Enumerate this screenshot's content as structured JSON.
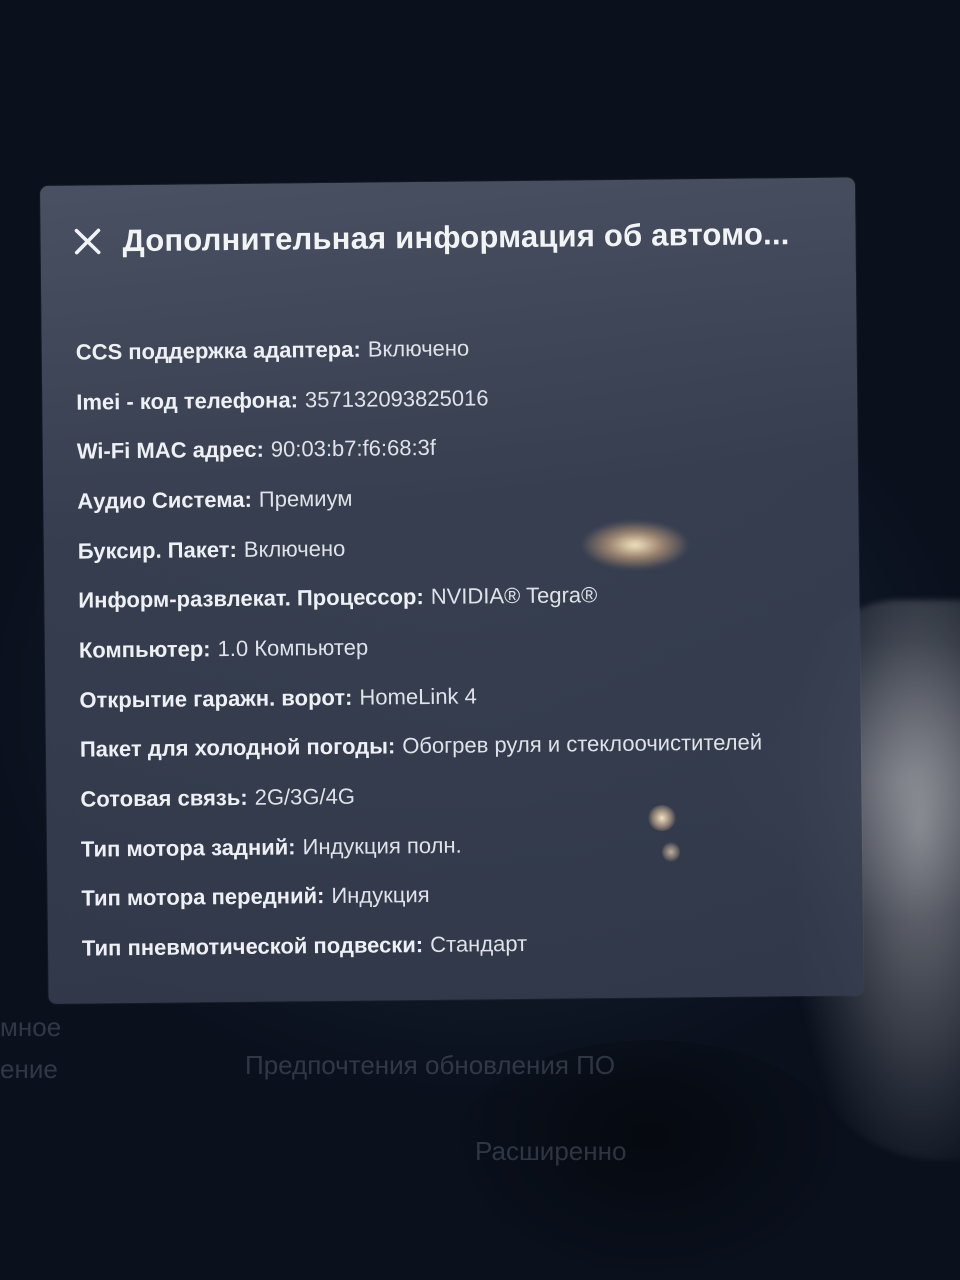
{
  "dialog": {
    "title": "Дополнительная информация об автомо...",
    "close_icon": "close-icon"
  },
  "info": [
    {
      "key": "CCS поддержка адаптера",
      "value": "Включено"
    },
    {
      "key": "Imei - код телефона",
      "value": "357132093825016"
    },
    {
      "key": "Wi-Fi MAC адрес",
      "value": "90:03:b7:f6:68:3f"
    },
    {
      "key": "Аудио Система",
      "value": "Премиум"
    },
    {
      "key": "Буксир. Пакет",
      "value": "Включено"
    },
    {
      "key": "Информ-развлекат. Процессор",
      "value": "NVIDIA® Tegra®"
    },
    {
      "key": "Компьютер",
      "value": "1.0 Компьютер"
    },
    {
      "key": "Открытие гаражн. ворот",
      "value": "HomeLink 4"
    },
    {
      "key": "Пакет для холодной погоды",
      "value": "Обогрев руля и стеклоочистителей"
    },
    {
      "key": "Сотовая связь",
      "value": "2G/3G/4G"
    },
    {
      "key": "Тип мотора задний",
      "value": "Индукция полн."
    },
    {
      "key": "Тип мотора передний",
      "value": "Индукция"
    },
    {
      "key": "Тип пневмотической подвески",
      "value": "Стандарт"
    }
  ],
  "background": {
    "left_label_1": "мное",
    "left_label_2": "ение",
    "software_update_prefs": "Предпочтения обновления ПО",
    "advanced": "Расширенно"
  }
}
